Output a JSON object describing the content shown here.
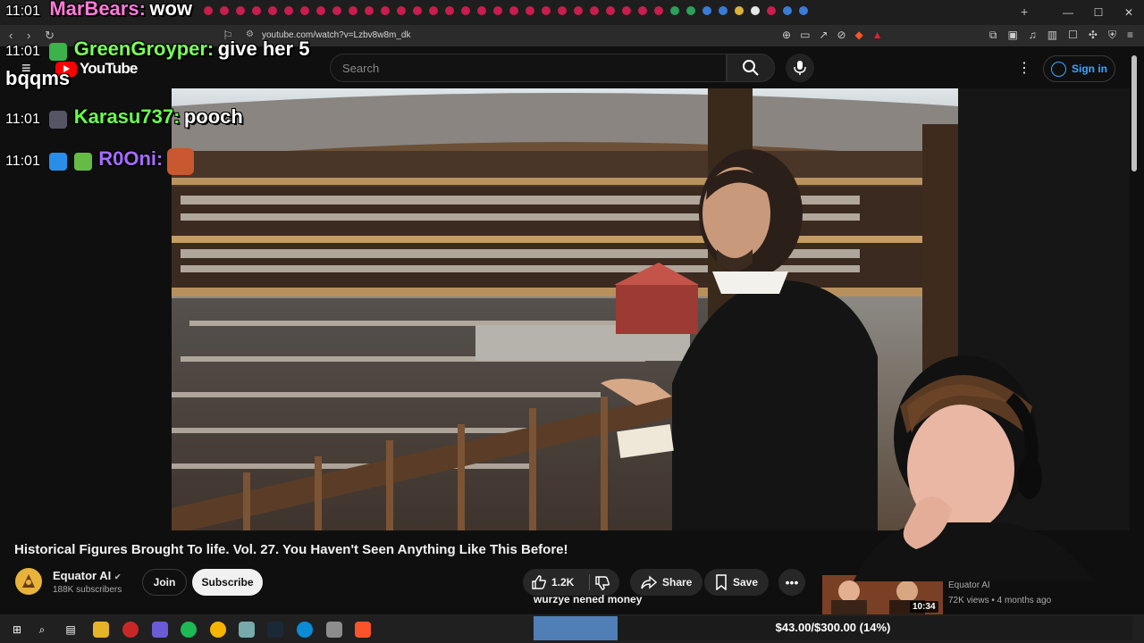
{
  "browser": {
    "url": "youtube.com/watch?v=Lzbv8w8m_dk",
    "window_controls": [
      "—",
      "☐",
      "✕"
    ]
  },
  "youtube": {
    "logo_text": "YouTube",
    "search_placeholder": "Search",
    "signin_label": "Sign in"
  },
  "chat": [
    {
      "time": "11:01",
      "user": "MarBears:",
      "user_color": "#ff7ad9",
      "msg": "wow",
      "badges": []
    },
    {
      "time": "11:01",
      "user": "GreenGroyper:",
      "user_color": "#7cff5b",
      "msg": "give her 5",
      "msg2": "bqqms",
      "badges": [
        "#3bb34a"
      ]
    },
    {
      "time": "11:01",
      "user": "Karasu737:",
      "user_color": "#6aff4d",
      "msg": "pooch",
      "badges": [
        "#556"
      ]
    },
    {
      "time": "11:01",
      "user": "R0Oni:",
      "user_color": "#a46cff",
      "msg": "",
      "badges": [
        "#2a8ee8",
        "#6b4"
      ]
    }
  ],
  "video": {
    "title": "Historical Figures Brought To life. Vol. 27. You Haven't Seen Anything Like This Before!",
    "channel": "Equator AI",
    "verified": "✔",
    "subscribers": "188K subscribers",
    "join_label": "Join",
    "subscribe_label": "Subscribe",
    "likes": "1.2K",
    "share_label": "Share",
    "save_label": "Save",
    "more_label": "•••"
  },
  "recommended": {
    "channel": "Equator AI",
    "views": "72K views • 4 months ago",
    "duration": "10:34"
  },
  "overlay": {
    "caption": "wurzye nened money",
    "goal_text": "$43.00/$300.00 (14%)",
    "goal_fraction": 0.14
  },
  "colors": {
    "yt_red": "#ff0000",
    "link_blue": "#3ea6ff",
    "goal_blue": "#4f7fb6"
  },
  "icons": {
    "search": "search-icon",
    "mic": "mic-icon",
    "like": "thumbs-up-icon",
    "dislike": "thumbs-down-icon",
    "share": "share-icon",
    "save": "bookmark-icon"
  }
}
